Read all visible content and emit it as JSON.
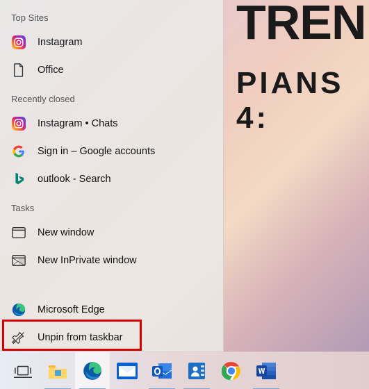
{
  "wallpaper": {
    "line1": "TREN",
    "line2": "PIANS 4:"
  },
  "jumplist": {
    "sections": [
      {
        "title": "Top Sites",
        "items": [
          {
            "icon": "instagram",
            "label": "Instagram"
          },
          {
            "icon": "office",
            "label": "Office"
          }
        ]
      },
      {
        "title": "Recently closed",
        "items": [
          {
            "icon": "instagram",
            "label": "Instagram • Chats"
          },
          {
            "icon": "google",
            "label": "Sign in – Google accounts"
          },
          {
            "icon": "bing",
            "label": "outlook - Search"
          }
        ]
      },
      {
        "title": "Tasks",
        "items": [
          {
            "icon": "window",
            "label": "New window"
          },
          {
            "icon": "private",
            "label": "New InPrivate window"
          }
        ]
      }
    ],
    "footer": [
      {
        "icon": "edge",
        "label": "Microsoft Edge"
      },
      {
        "icon": "unpin",
        "label": "Unpin from taskbar"
      }
    ]
  },
  "taskbar": {
    "items": [
      {
        "icon": "taskview",
        "name": "task-view"
      },
      {
        "icon": "explorer",
        "name": "file-explorer",
        "running": true
      },
      {
        "icon": "edge",
        "name": "microsoft-edge",
        "active": true,
        "running": true
      },
      {
        "icon": "mail",
        "name": "mail"
      },
      {
        "icon": "outlook",
        "name": "outlook",
        "running": true
      },
      {
        "icon": "contact",
        "name": "contact-book",
        "running": true
      },
      {
        "icon": "chrome",
        "name": "google-chrome"
      },
      {
        "icon": "word",
        "name": "microsoft-word",
        "running": true
      }
    ]
  }
}
